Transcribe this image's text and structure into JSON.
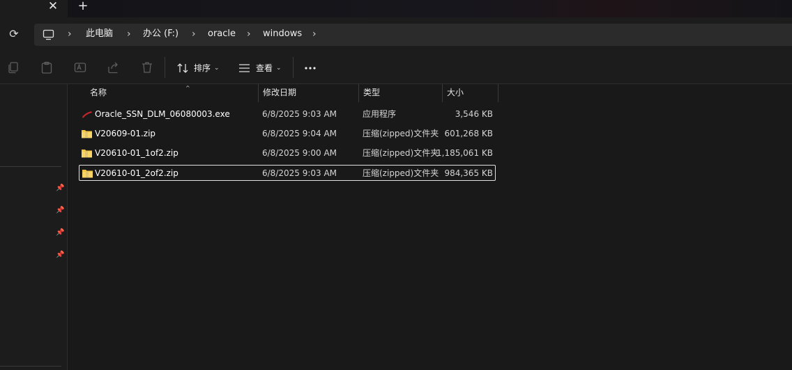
{
  "tabs": {
    "close_glyph": "✕",
    "new_glyph": "+"
  },
  "address": {
    "refresh_glyph": "⟳",
    "crumbs": [
      "此电脑",
      "办公 (F:)",
      "oracle",
      "windows"
    ],
    "chevron": "›"
  },
  "toolbar": {
    "sort_label": "排序",
    "view_label": "查看",
    "caret": "⌄"
  },
  "columns": {
    "name": "名称",
    "modified": "修改日期",
    "type": "类型",
    "size": "大小",
    "sort_indicator": "^"
  },
  "files": [
    {
      "name": "Oracle_SSN_DLM_06080003.exe",
      "modified": "6/8/2025 9:03 AM",
      "type": "应用程序",
      "size": "3,546 KB",
      "icon": "exe-icon"
    },
    {
      "name": "V20609-01.zip",
      "modified": "6/8/2025 9:04 AM",
      "type": "压缩(zipped)文件夹",
      "size": "601,268 KB",
      "icon": "zip-folder-icon"
    },
    {
      "name": "V20610-01_1of2.zip",
      "modified": "6/8/2025 9:00 AM",
      "type": "压缩(zipped)文件夹",
      "size": "1,185,061 KB",
      "icon": "zip-folder-icon"
    },
    {
      "name": "V20610-01_2of2.zip",
      "modified": "6/8/2025 9:03 AM",
      "type": "压缩(zipped)文件夹",
      "size": "984,365 KB",
      "icon": "zip-folder-icon",
      "selected": true
    }
  ],
  "colors": {
    "background": "#191919",
    "chrome": "#1c1c1c",
    "address_bar": "#2b2b2b",
    "folder_yellow": "#f6c646",
    "exe_red": "#c0262b"
  }
}
